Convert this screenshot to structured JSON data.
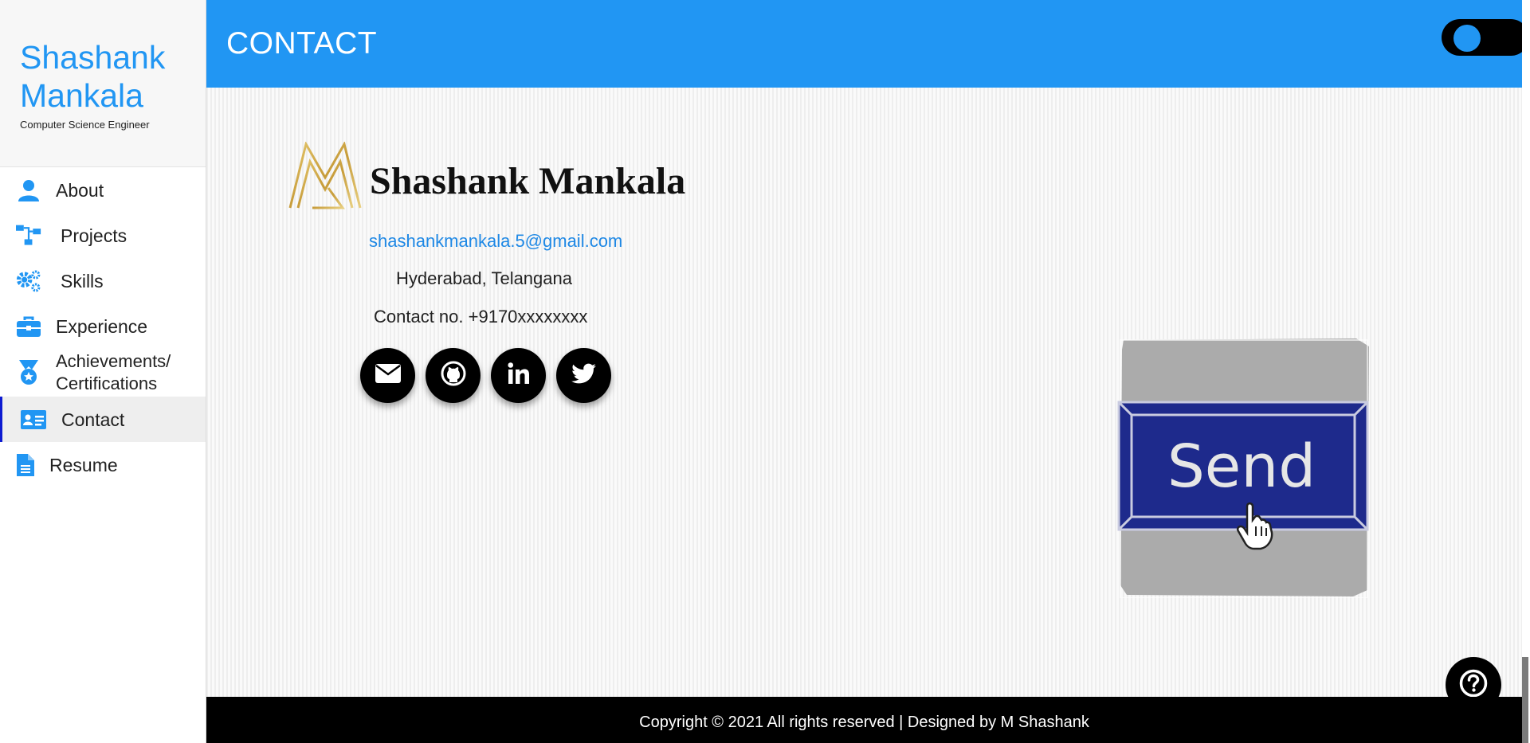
{
  "sidebar": {
    "brand_name": "Shashank Mankala",
    "brand_tagline": "Computer Science Engineer",
    "items": [
      {
        "label": "About",
        "icon": "user-icon"
      },
      {
        "label": "Projects",
        "icon": "project-tree-icon"
      },
      {
        "label": "Skills",
        "icon": "gears-icon"
      },
      {
        "label": "Experience",
        "icon": "briefcase-icon"
      },
      {
        "label": "Achievements/\nCertifications",
        "icon": "medal-icon"
      },
      {
        "label": "Contact",
        "icon": "id-card-icon",
        "active": true
      },
      {
        "label": "Resume",
        "icon": "document-icon"
      }
    ]
  },
  "header": {
    "title": "CONTACT",
    "theme_toggle": "on"
  },
  "contact": {
    "name": "Shashank Mankala",
    "email": "shashankmankala.5@gmail.com",
    "location": "Hyderabad, Telangana",
    "phone": "Contact no. +9170xxxxxxxx",
    "socials": [
      "envelope-icon",
      "github-icon",
      "linkedin-icon",
      "twitter-icon"
    ]
  },
  "send_widget": {
    "label": "Send"
  },
  "footer": {
    "text": "Copyright © 2021 All rights reserved | Designed by M Shashank"
  },
  "colors": {
    "accent": "#2196f3",
    "active_border": "#0d1bd1",
    "logo_gold": "#c9a545",
    "send_blue": "#1e2a8c"
  }
}
